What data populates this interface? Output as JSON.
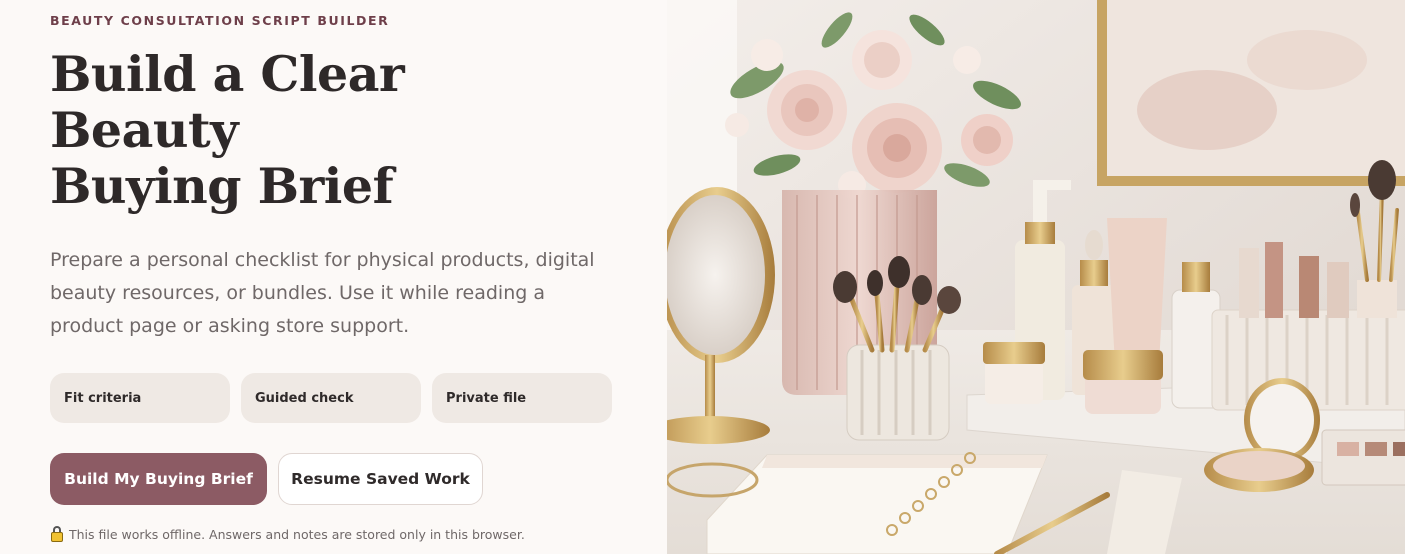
{
  "eyebrow": "BEAUTY CONSULTATION SCRIPT BUILDER",
  "headline": {
    "line1": "Build a Clear",
    "line2": "Beauty",
    "line3": "Buying Brief"
  },
  "intro": "Prepare a personal checklist for physical products, digital beauty resources, or bundles. Use it while reading a product page or asking store support.",
  "chips": [
    {
      "label": "Fit criteria"
    },
    {
      "label": "Guided check"
    },
    {
      "label": "Private file"
    }
  ],
  "actions": {
    "primary_label": "Build My Buying Brief",
    "secondary_label": "Resume Saved Work"
  },
  "note": {
    "icon": "lock-icon",
    "text": "This file works offline. Answers and notes are stored only in this browser."
  },
  "hero_image": {
    "description_icon": "vanity-photo",
    "alt": ""
  },
  "colors": {
    "accent": "#8c5b64",
    "eyebrow": "#6e3f4a",
    "chip_bg": "#efe9e4",
    "page_bg": "#fcf9f7"
  }
}
